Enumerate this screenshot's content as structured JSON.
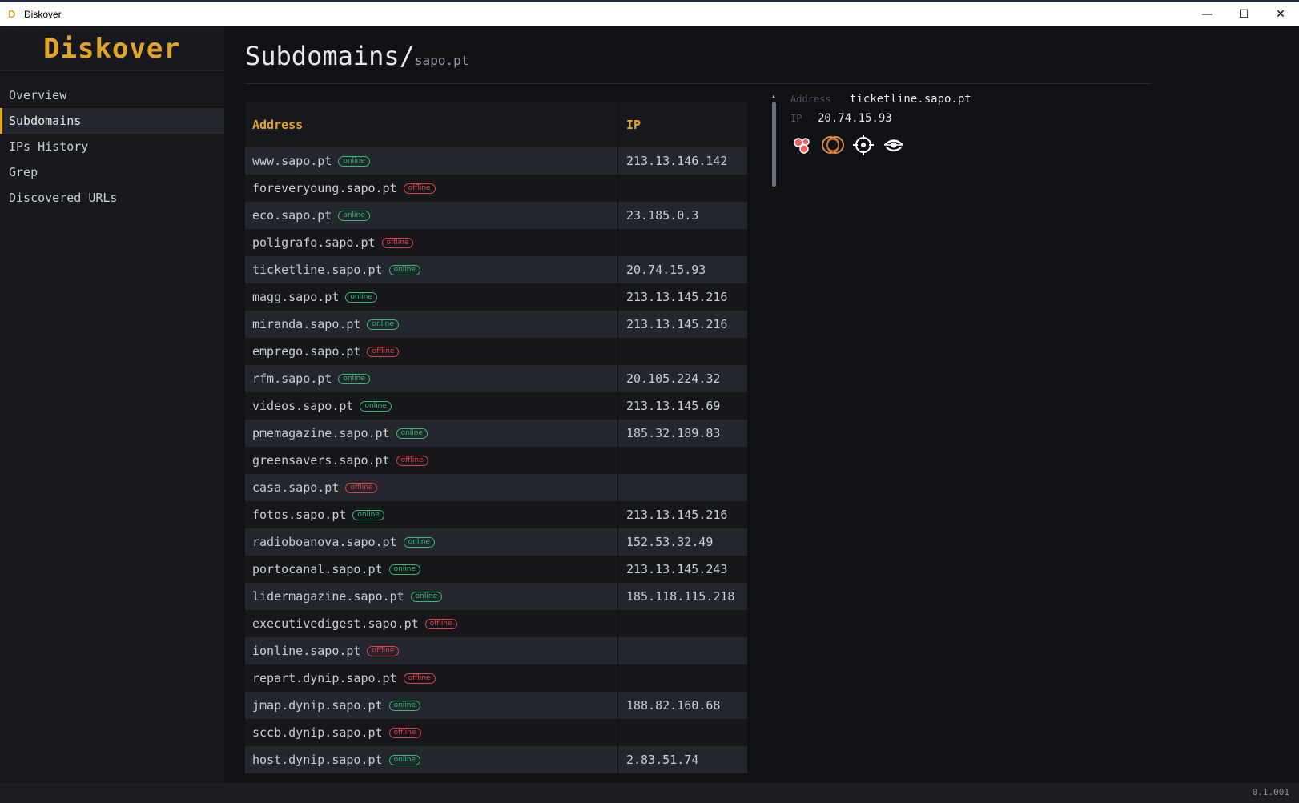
{
  "window": {
    "app_icon": "D",
    "title": "Diskover",
    "controls": {
      "minimize": "—",
      "maximize": "☐",
      "close": "✕"
    }
  },
  "sidebar": {
    "logo": "Diskover",
    "items": [
      {
        "label": "Overview",
        "active": false
      },
      {
        "label": "Subdomains",
        "active": true
      },
      {
        "label": "IPs History",
        "active": false
      },
      {
        "label": "Grep",
        "active": false
      },
      {
        "label": "Discovered URLs",
        "active": false
      }
    ]
  },
  "page": {
    "title": "Subdomains/",
    "subtitle": "sapo.pt"
  },
  "table": {
    "headers": {
      "address": "Address",
      "ip": "IP"
    },
    "rows": [
      {
        "address": "www.sapo.pt",
        "status": "online",
        "ip": "213.13.146.142"
      },
      {
        "address": "foreveryoung.sapo.pt",
        "status": "offline",
        "ip": ""
      },
      {
        "address": "eco.sapo.pt",
        "status": "online",
        "ip": "23.185.0.3"
      },
      {
        "address": "poligrafo.sapo.pt",
        "status": "offline",
        "ip": ""
      },
      {
        "address": "ticketline.sapo.pt",
        "status": "online",
        "ip": "20.74.15.93"
      },
      {
        "address": "magg.sapo.pt",
        "status": "online",
        "ip": "213.13.145.216"
      },
      {
        "address": "miranda.sapo.pt",
        "status": "online",
        "ip": "213.13.145.216"
      },
      {
        "address": "emprego.sapo.pt",
        "status": "offline",
        "ip": ""
      },
      {
        "address": "rfm.sapo.pt",
        "status": "online",
        "ip": "20.105.224.32"
      },
      {
        "address": "videos.sapo.pt",
        "status": "online",
        "ip": "213.13.145.69"
      },
      {
        "address": "pmemagazine.sapo.pt",
        "status": "online",
        "ip": "185.32.189.83"
      },
      {
        "address": "greensavers.sapo.pt",
        "status": "offline",
        "ip": ""
      },
      {
        "address": "casa.sapo.pt",
        "status": "offline",
        "ip": ""
      },
      {
        "address": "fotos.sapo.pt",
        "status": "online",
        "ip": "213.13.145.216"
      },
      {
        "address": "radioboanova.sapo.pt",
        "status": "online",
        "ip": "152.53.32.49"
      },
      {
        "address": "portocanal.sapo.pt",
        "status": "online",
        "ip": "213.13.145.243"
      },
      {
        "address": "lidermagazine.sapo.pt",
        "status": "online",
        "ip": "185.118.115.218"
      },
      {
        "address": "executivedigest.sapo.pt",
        "status": "offline",
        "ip": ""
      },
      {
        "address": "ionline.sapo.pt",
        "status": "offline",
        "ip": ""
      },
      {
        "address": "repart.dynip.sapo.pt",
        "status": "offline",
        "ip": ""
      },
      {
        "address": "jmap.dynip.sapo.pt",
        "status": "online",
        "ip": "188.82.160.68"
      },
      {
        "address": "sccb.dynip.sapo.pt",
        "status": "offline",
        "ip": ""
      },
      {
        "address": "host.dynip.sapo.pt",
        "status": "online",
        "ip": "2.83.51.74"
      }
    ]
  },
  "detail": {
    "address_label": "Address",
    "address_value": "ticketline.sapo.pt",
    "ip_label": "IP",
    "ip_value": "20.74.15.93",
    "icons": [
      "bubbles-icon",
      "rings-icon",
      "crosshair-icon",
      "eye-scan-icon"
    ]
  },
  "footer": {
    "version": "0.1.001"
  },
  "colors": {
    "accent": "#e3a524",
    "online": "#2fbf71",
    "offline": "#e0404a"
  }
}
